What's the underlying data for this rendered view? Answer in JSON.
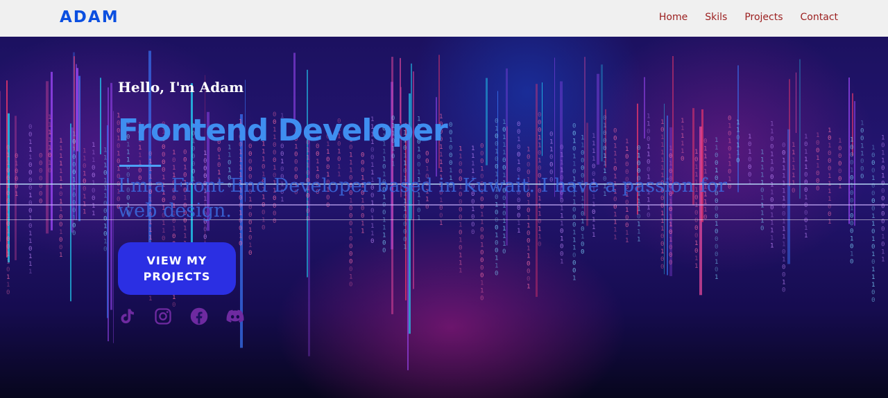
{
  "navbar": {
    "logo": "ADAM",
    "links": [
      "Home",
      "Skils",
      "Projects",
      "Contact"
    ]
  },
  "hero": {
    "greeting": "Hello, I'm Adam",
    "title": "Frontend Developer",
    "description": "I'm a Front End Developer based in Kuwait. I have a passion for web design.",
    "cta_label": "VIEW MY PROJECTS",
    "socials": [
      "tiktok-icon",
      "instagram-icon",
      "facebook-icon",
      "discord-icon"
    ]
  },
  "colors": {
    "logo": "#0b4fe0",
    "nav_link": "#9b1e1e",
    "title": "#3f8ef0",
    "button": "#2b2fe3",
    "social": "#7a2aa6"
  }
}
